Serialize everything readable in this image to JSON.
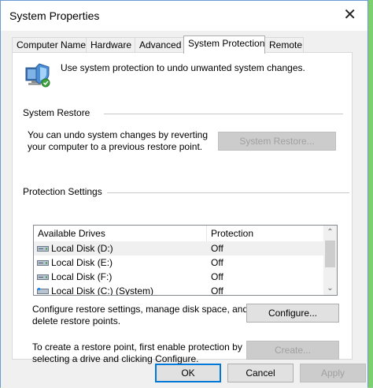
{
  "window": {
    "title": "System Properties",
    "close_glyph": "✕"
  },
  "tabs": [
    {
      "label": "Computer Name"
    },
    {
      "label": "Hardware"
    },
    {
      "label": "Advanced"
    },
    {
      "label": "System Protection",
      "active": true
    },
    {
      "label": "Remote"
    }
  ],
  "intro_text": "Use system protection to undo unwanted system changes.",
  "system_restore": {
    "group_label": "System Restore",
    "line1": "You can undo system changes by reverting",
    "line2": "your computer to a previous restore point.",
    "button_label": "System Restore...",
    "button_enabled": false
  },
  "protection_settings": {
    "group_label": "Protection Settings",
    "columns": [
      "Available Drives",
      "Protection"
    ],
    "drives": [
      {
        "name": "Local Disk (D:)",
        "protection": "Off",
        "selected": true
      },
      {
        "name": "Local Disk (E:)",
        "protection": "Off"
      },
      {
        "name": "Local Disk (F:)",
        "protection": "Off"
      },
      {
        "name": "Local Disk (C:) (System)",
        "protection": "Off"
      }
    ],
    "configure_line1": "Configure restore settings, manage disk space, and",
    "configure_line2": "delete restore points.",
    "configure_button": "Configure...",
    "create_line1": "To create a restore point, first enable protection by",
    "create_line2": "selecting a drive and clicking Configure.",
    "create_button": "Create...",
    "create_enabled": false
  },
  "footer": {
    "ok": "OK",
    "cancel": "Cancel",
    "apply": "Apply",
    "apply_enabled": false
  },
  "icons": {
    "system_protection": "computer-shield-icon",
    "drive": "hard-drive-icon",
    "scroll_up": "chevron-up-icon",
    "scroll_down": "chevron-down-icon"
  },
  "colors": {
    "accent": "#0078d7",
    "panel": "#f0f0f0",
    "disabled_text": "#a0a0a0"
  }
}
